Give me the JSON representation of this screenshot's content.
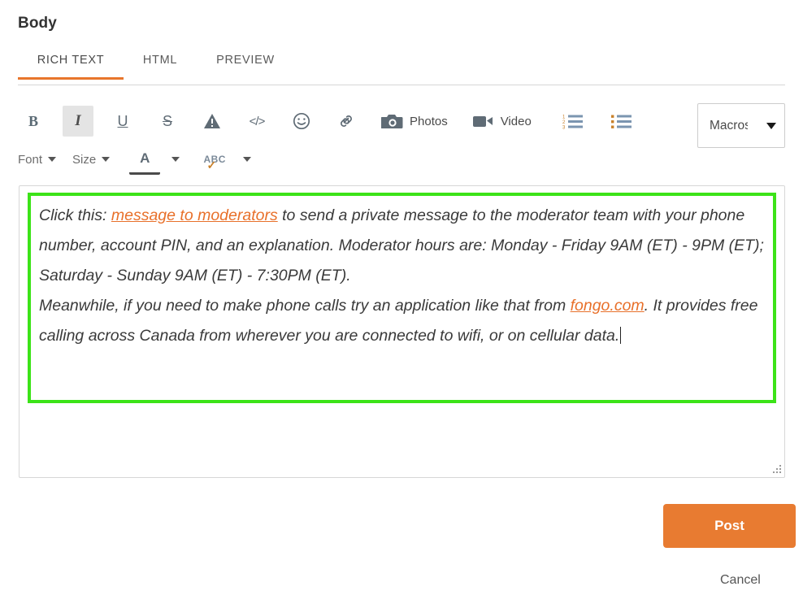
{
  "page_title": "Body",
  "tabs": [
    {
      "label": "RICH TEXT",
      "active": true
    },
    {
      "label": "HTML",
      "active": false
    },
    {
      "label": "PREVIEW",
      "active": false
    }
  ],
  "toolbar": {
    "row1": {
      "bold": "B",
      "italic": "I",
      "underline": "U",
      "strikethrough": "S",
      "spoiler": "!",
      "code": "</>",
      "emoji": "☺",
      "link": "link-icon",
      "photos_label": "Photos",
      "video_label": "Video",
      "numbered_list": "numbered-list-icon",
      "bullet_list": "bullet-list-icon"
    },
    "row2": {
      "font_label": "Font",
      "size_label": "Size",
      "text_color": "A",
      "spellcheck": "ABC"
    },
    "macros": {
      "selected": "Macros"
    }
  },
  "editor": {
    "paragraph1": {
      "lead": "Click this: ",
      "link_text": "message to moderators",
      "rest": " to send a private message to the moderator team with your phone number, account PIN, and an explanation. Moderator hours are: Monday - Friday 9AM (ET) - 9PM (ET); Saturday - Sunday 9AM (ET) - 7:30PM (ET)."
    },
    "paragraph2": {
      "lead": "Meanwhile, if you need to make phone calls try an application like that from ",
      "link_text": "fongo.com",
      "rest": ". It provides free calling across Canada from wherever you are connected to wifi, or on cellular data."
    }
  },
  "actions": {
    "post_label": "Post",
    "cancel_label": "Cancel"
  },
  "colors": {
    "accent_orange": "#e8762c",
    "post_button": "#e87b31",
    "selection_green": "#3ce318",
    "link_orange": "#e8702a"
  }
}
